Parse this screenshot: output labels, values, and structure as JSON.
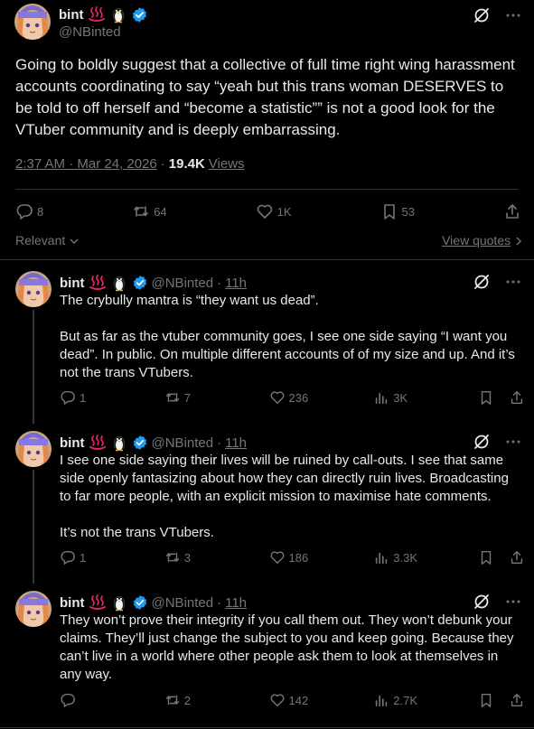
{
  "main_tweet": {
    "display_name": "bint",
    "emojis": [
      "hot-springs-emoji",
      "penguin-emoji"
    ],
    "handle": "@NBinted",
    "text": "Going to boldly suggest that a collective of full time right wing harassment accounts coordinating to say “yeah but this trans woman DESERVES to be told to off herself and “become a statistic”” is not a good look for the VTuber community and is deeply embarrassing.",
    "timestamp": "2:37 AM · Mar 24, 2026",
    "views_count": "19.4K",
    "views_label": "Views",
    "replies": "8",
    "reposts": "64",
    "likes": "1K",
    "bookmarks": "53"
  },
  "sort": {
    "label": "Relevant",
    "view_quotes": "View quotes"
  },
  "replies": [
    {
      "display_name": "bint",
      "handle": "@NBinted",
      "time": "11h",
      "paragraphs": [
        "The crybully mantra is “they want us dead”.",
        "But as far as the vtuber community goes, I see one side saying “I want you dead”. In public. On multiple different accounts of of my size and up. And it’s not the trans VTubers."
      ],
      "replies": "1",
      "reposts": "7",
      "likes": "236",
      "views": "3K"
    },
    {
      "display_name": "bint",
      "handle": "@NBinted",
      "time": "11h",
      "paragraphs": [
        "I see one side saying their lives will be ruined by call-outs. I see that same side openly fantasizing about how they can directly ruin lives. Broadcasting to far more people, with an explicit mission to maximise hate comments.",
        "It’s not the trans VTubers."
      ],
      "replies": "1",
      "reposts": "3",
      "likes": "186",
      "views": "3.3K"
    },
    {
      "display_name": "bint",
      "handle": "@NBinted",
      "time": "11h",
      "paragraphs": [
        "They won’t prove their integrity if you call them out. They won’t debunk your claims. They’ll just change the subject to you and keep going. Because they can’t live in a world where other people ask them to look at themselves in any way."
      ],
      "replies": "",
      "reposts": "2",
      "likes": "142",
      "views": "2.7K"
    }
  ],
  "dot": "·",
  "colors": {
    "background": "#000000",
    "text": "#e7e9ea",
    "muted": "#71767b",
    "divider": "#2f3336",
    "verified": "#1d9bf0",
    "hotsprings": "#e0245e"
  }
}
